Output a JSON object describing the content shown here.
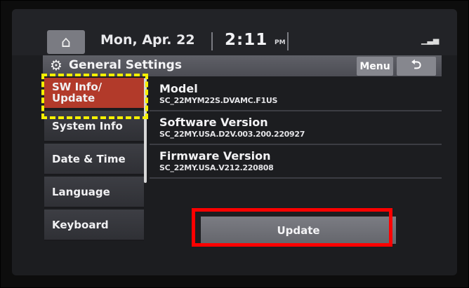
{
  "status_bar": {
    "date": "Mon, Apr. 22",
    "time": "2:11",
    "ampm": "PM",
    "signal_icon": "signal-bars-icon"
  },
  "header": {
    "icon": "gear-icon",
    "title": "General Settings",
    "menu_label": "Menu",
    "back_icon": "back-arrow-icon"
  },
  "sidebar": {
    "items": [
      {
        "label": "SW Info/\nUpdate",
        "active": true
      },
      {
        "label": "System Info",
        "active": false
      },
      {
        "label": "Date & Time",
        "active": false
      },
      {
        "label": "Language",
        "active": false
      },
      {
        "label": "Keyboard",
        "active": false
      }
    ]
  },
  "content": {
    "rows": [
      {
        "title": "Model",
        "value": "SC_22MYM22S.DVAMC.F1US"
      },
      {
        "title": "Software Version",
        "value": "SC_22MY.USA.D2V.003.200.220927"
      },
      {
        "title": "Firmware Version",
        "value": "SC_22MY.USA.V212.220808"
      }
    ],
    "update_label": "Update"
  },
  "annotations": {
    "highlight_colors": {
      "dashed": "#f5f000",
      "solid": "#ff0000"
    }
  }
}
